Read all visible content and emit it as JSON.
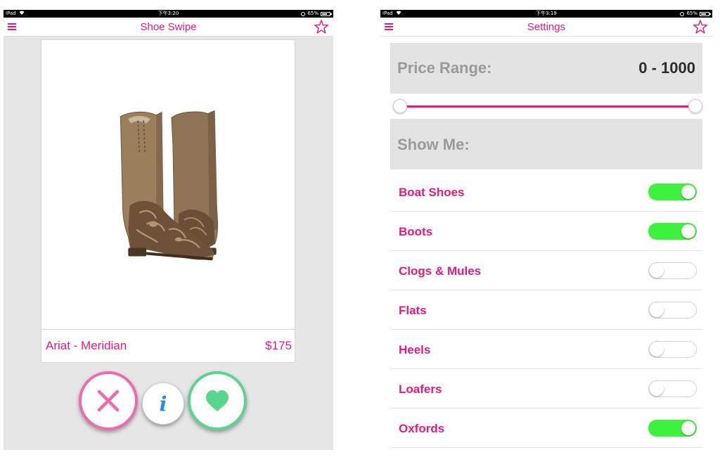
{
  "left_screen": {
    "status_bar": {
      "carrier": "iPad",
      "time": "下午3:20",
      "battery": "65%"
    },
    "nav": {
      "title": "Shoe Swipe",
      "menu_icon": "hamburger-menu-icon",
      "favorite_icon": "star-outline-icon"
    },
    "card": {
      "image": "brown-cowboy-boots",
      "product_name": "Ariat - Meridian",
      "price": "$175"
    },
    "actions": {
      "dislike_icon": "x-icon",
      "info_icon": "info-icon",
      "info_text": "i",
      "like_icon": "heart-icon"
    }
  },
  "right_screen": {
    "status_bar": {
      "carrier": "iPad",
      "time": "下午3:19",
      "battery": "65%"
    },
    "nav": {
      "title": "Settings",
      "menu_icon": "hamburger-menu-icon",
      "favorite_icon": "star-outline-icon"
    },
    "price_range": {
      "label": "Price Range:",
      "value": "0 - 1000",
      "min_fraction": 0,
      "max_fraction": 1
    },
    "show_me": {
      "label": "Show Me:"
    },
    "categories": [
      {
        "label": "Boat Shoes",
        "enabled": true
      },
      {
        "label": "Boots",
        "enabled": true
      },
      {
        "label": "Clogs & Mules",
        "enabled": false
      },
      {
        "label": "Flats",
        "enabled": false
      },
      {
        "label": "Heels",
        "enabled": false
      },
      {
        "label": "Loafers",
        "enabled": false
      },
      {
        "label": "Oxfords",
        "enabled": true
      }
    ]
  },
  "colors": {
    "accent_pink": "#e8197e",
    "dislike_pink": "#f06aa9",
    "like_green": "#58d68d",
    "info_blue": "#2a8be8",
    "toggle_on": "#3cf23c",
    "section_gray": "#e3e3e3"
  }
}
